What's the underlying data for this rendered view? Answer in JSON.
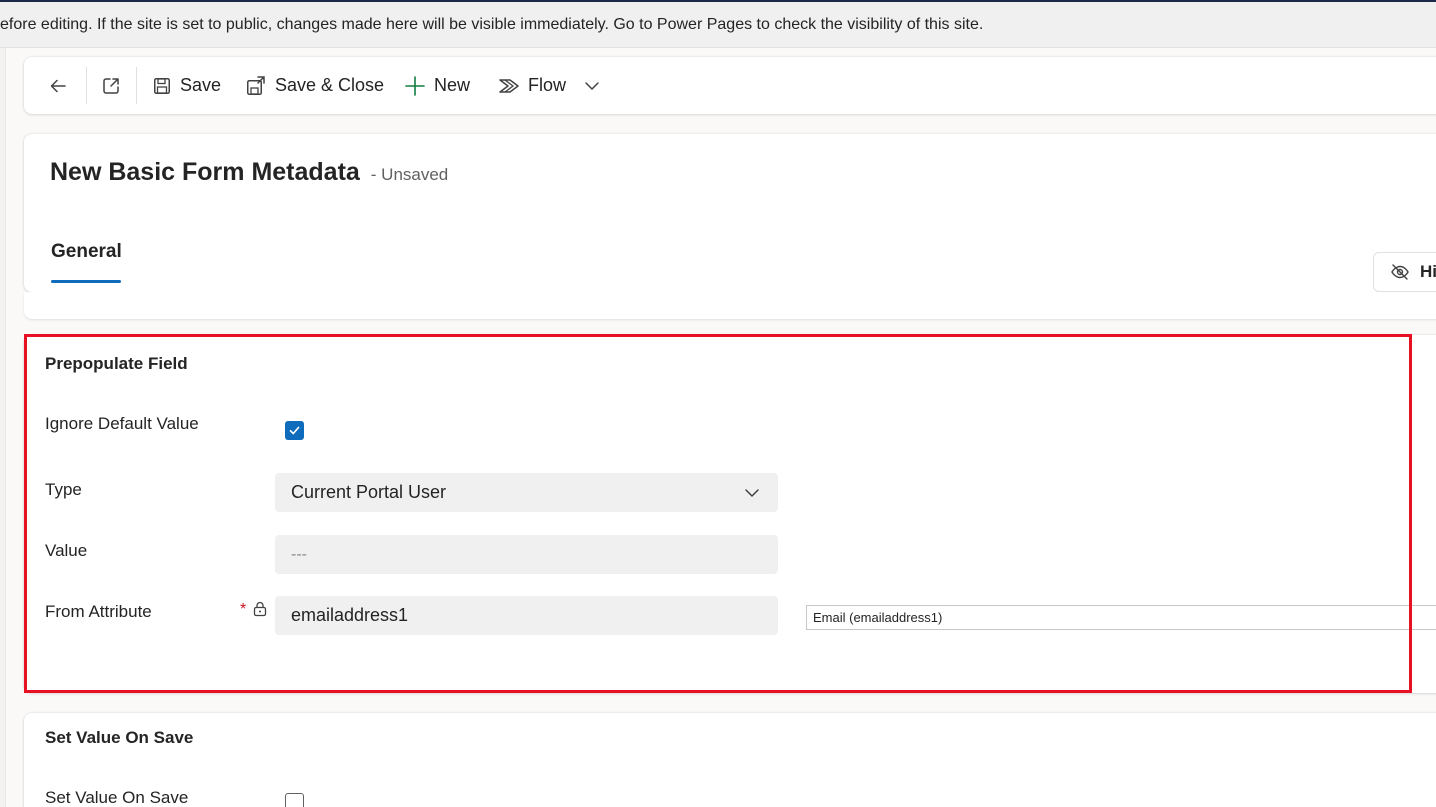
{
  "banner": {
    "text": "efore editing. If the site is set to public, changes made here will be visible immediately. Go to Power Pages to check the visibility of this site."
  },
  "toolbar": {
    "back_icon": "arrow-left-icon",
    "popout_icon": "open-in-new-window-icon",
    "save_label": "Save",
    "save_close_label": "Save & Close",
    "new_label": "New",
    "flow_label": "Flow"
  },
  "header": {
    "title": "New Basic Form Metadata",
    "status": "- Unsaved",
    "tab_general": "General",
    "hide_label": "Hi"
  },
  "prepopulate": {
    "section_title": "Prepopulate Field",
    "ignore_default_label": "Ignore Default Value",
    "ignore_default_checked": true,
    "type_label": "Type",
    "type_value": "Current Portal User",
    "value_label": "Value",
    "value_placeholder": "---",
    "from_attribute_label": "From Attribute",
    "from_attribute_required": "*",
    "from_attribute_value": "emailaddress1",
    "attribute_lookup_value": "Email (emailaddress1)"
  },
  "set_value_on_save": {
    "section_title": "Set Value On Save",
    "checkbox_label": "Set Value On Save",
    "checked": false
  },
  "colors": {
    "accent": "#0f6cbd",
    "highlight_border": "#e81123",
    "required": "#c50f1f",
    "new_icon": "#107c41"
  }
}
